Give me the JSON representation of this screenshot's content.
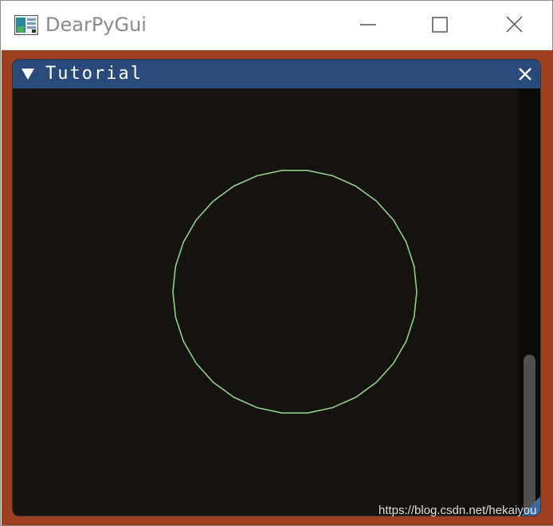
{
  "app": {
    "title": "DearPyGui",
    "icon": "app-window-icon"
  },
  "window_controls": {
    "minimize_icon": "minimize-icon",
    "maximize_icon": "maximize-icon",
    "close_icon": "close-icon"
  },
  "imgui_window": {
    "title": "Tutorial",
    "collapse_icon": "triangle-down-icon",
    "close_icon": "close-icon",
    "title_bar_color": "#294a7a",
    "background_color": "#161210"
  },
  "canvas": {
    "shape": "circle",
    "stroke_color": "#8fcf86",
    "background_color": "#161210"
  },
  "host_background_color": "#9e3f1f",
  "watermark": "https://blog.csdn.net/hekaiyou"
}
